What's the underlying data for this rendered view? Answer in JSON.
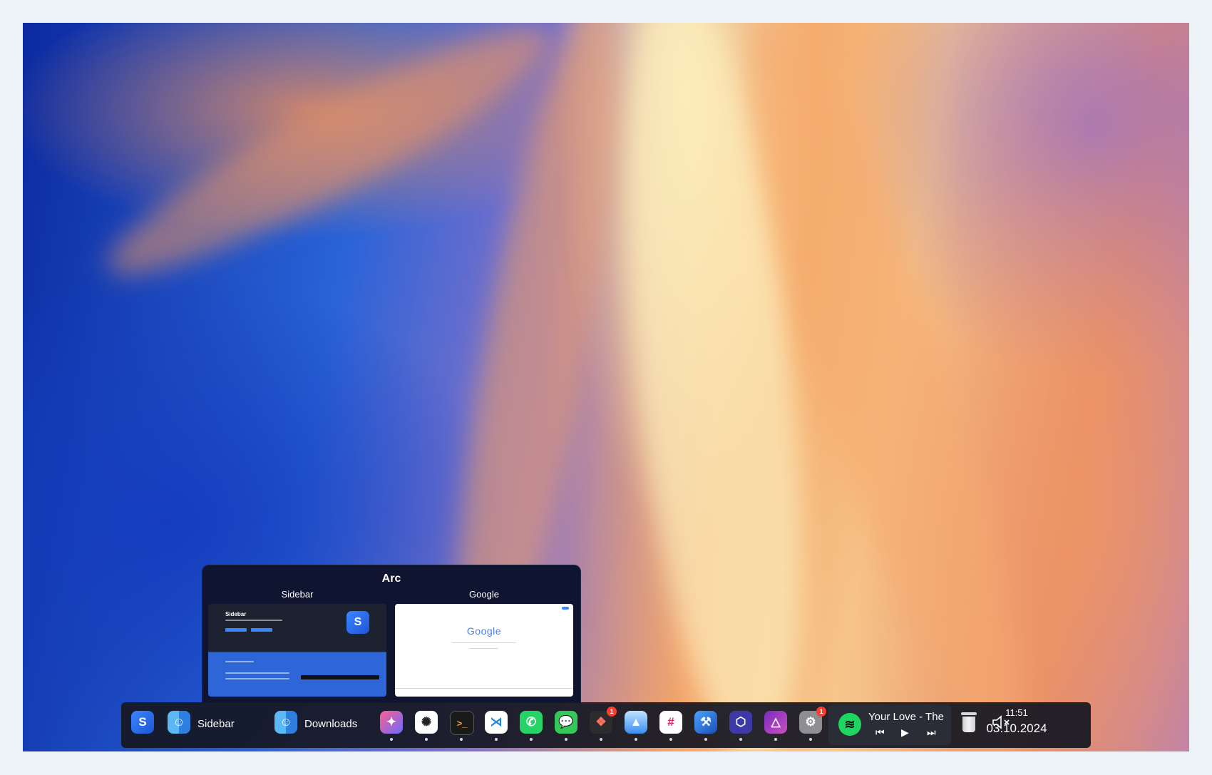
{
  "arc_preview": {
    "title": "Arc",
    "windows": [
      {
        "label": "Sidebar",
        "thumb_heading": "Sidebar",
        "thumb_logo": "S"
      },
      {
        "label": "Google",
        "thumb_heading": "Google"
      }
    ]
  },
  "dock": {
    "launcher": {
      "icon": "sidebar-app-icon",
      "glyph": "S"
    },
    "tasks": [
      {
        "label": "Sidebar",
        "icon": "finder-icon"
      },
      {
        "label": "Downloads",
        "icon": "finder-icon"
      }
    ],
    "apps": [
      {
        "name": "arc",
        "icon": "arc-icon"
      },
      {
        "name": "chatgpt",
        "icon": "chatgpt-icon"
      },
      {
        "name": "terminal",
        "icon": "terminal-icon"
      },
      {
        "name": "vscode",
        "icon": "vscode-icon"
      },
      {
        "name": "whatsapp",
        "icon": "whatsapp-icon"
      },
      {
        "name": "messages",
        "icon": "messages-icon"
      },
      {
        "name": "figma",
        "icon": "figma-icon",
        "badge": "1"
      },
      {
        "name": "testflight",
        "icon": "testflight-icon"
      },
      {
        "name": "slack",
        "icon": "slack-icon"
      },
      {
        "name": "xcode",
        "icon": "xcode-icon"
      },
      {
        "name": "3d-box",
        "icon": "cube-icon"
      },
      {
        "name": "affinity",
        "icon": "affinity-icon"
      },
      {
        "name": "system-settings",
        "icon": "settings-icon",
        "badge": "1"
      }
    ],
    "media": {
      "title": "Your Love - The",
      "icon": "spotify-icon",
      "prev": "⏮",
      "play": "▶",
      "next": "⏭"
    },
    "trash": {
      "icon": "trash-icon"
    },
    "volume": {
      "icon": "volume-muted-icon"
    },
    "clock": {
      "time": "11:51",
      "date": "03.10.2024"
    }
  },
  "colors": {
    "dock_bg": "#16182a",
    "badge": "#ff3b30",
    "spotify": "#1ed760"
  }
}
